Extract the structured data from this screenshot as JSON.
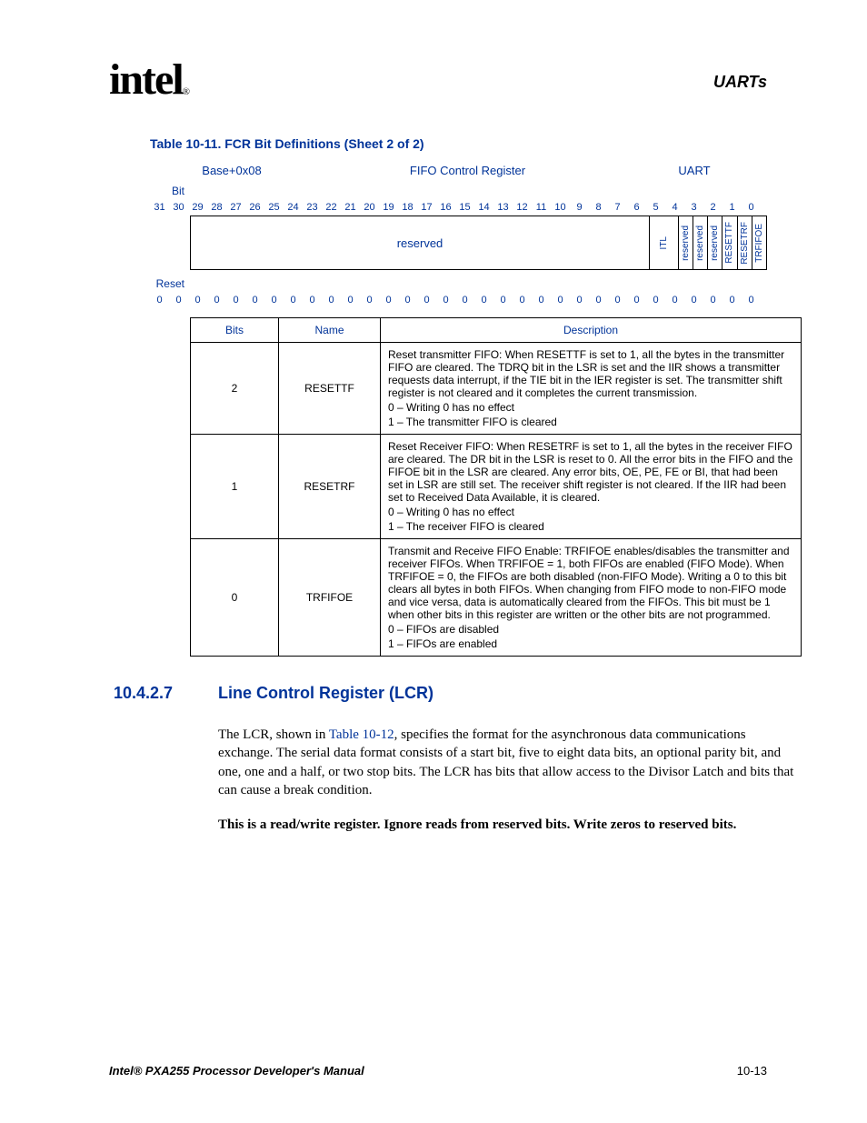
{
  "header": {
    "logo_text": "intel",
    "logo_r": "®",
    "chapter_title": "UARTs"
  },
  "table_title": "Table 10-11. FCR Bit Definitions (Sheet 2 of 2)",
  "register": {
    "address": "Base+0x08",
    "name": "FIFO Control Register",
    "module": "UART"
  },
  "labels": {
    "bit": "Bit",
    "reset": "Reset",
    "bits_col": "Bits",
    "name_col": "Name",
    "desc_col": "Description"
  },
  "bit_numbers": [
    "31",
    "30",
    "29",
    "28",
    "27",
    "26",
    "25",
    "24",
    "23",
    "22",
    "21",
    "20",
    "19",
    "18",
    "17",
    "16",
    "15",
    "14",
    "13",
    "12",
    "11",
    "10",
    "9",
    "8",
    "7",
    "6",
    "5",
    "4",
    "3",
    "2",
    "1",
    "0"
  ],
  "field_names": {
    "reserved": "reserved",
    "f7": "ITL",
    "f6": "ITL",
    "f5": "reserved",
    "f4": "reserved",
    "f3": "reserved",
    "f2": "RESETTF",
    "f1": "RESETRF",
    "f0": "TRFIFOE"
  },
  "reset_values": [
    "0",
    "0",
    "0",
    "0",
    "0",
    "0",
    "0",
    "0",
    "0",
    "0",
    "0",
    "0",
    "0",
    "0",
    "0",
    "0",
    "0",
    "0",
    "0",
    "0",
    "0",
    "0",
    "0",
    "0",
    "0",
    "0",
    "0",
    "0",
    "0",
    "0",
    "0",
    "0"
  ],
  "rows": [
    {
      "bits": "2",
      "name": "RESETTF",
      "desc_main": "Reset transmitter FIFO: When RESETTF is set to 1, all the bytes in the transmitter FIFO are cleared. The TDRQ bit in the LSR is set and the IIR shows a transmitter requests data interrupt, if the TIE bit in the IER register is set. The transmitter shift register is not cleared and it completes the current transmission.",
      "val0": "0 –  Writing 0 has no effect",
      "val1": "1 –  The transmitter FIFO is cleared"
    },
    {
      "bits": "1",
      "name": "RESETRF",
      "desc_main": "Reset Receiver FIFO: When RESETRF is set to 1, all the bytes in the receiver FIFO are cleared. The DR bit in the LSR is reset to 0. All the error bits in the FIFO and the FIFOE bit in the LSR are cleared. Any error bits, OE, PE, FE or BI, that had been set in LSR are still set. The receiver shift register is not cleared. If the IIR had been set to Received Data Available, it is cleared.",
      "val0": "0 –  Writing 0 has no effect",
      "val1": "1 –  The receiver FIFO is cleared"
    },
    {
      "bits": "0",
      "name": "TRFIFOE",
      "desc_main": "Transmit and Receive FIFO Enable: TRFIFOE enables/disables the transmitter and receiver FIFOs. When TRFIFOE = 1, both FIFOs are enabled (FIFO Mode). When TRFIFOE = 0, the FIFOs are both disabled (non-FIFO Mode). Writing a 0 to this bit clears all bytes in both FIFOs. When changing from FIFO mode to non-FIFO mode and vice versa, data is automatically cleared from the FIFOs. This bit must be 1 when other bits in this register are written or the other bits are not programmed.",
      "val0": "0 –  FIFOs are disabled",
      "val1": "1 –  FIFOs are enabled"
    }
  ],
  "section": {
    "number": "10.4.2.7",
    "title": "Line Control Register (LCR)"
  },
  "paragraph1a": "The LCR, shown in ",
  "paragraph1_xref": "Table 10-12",
  "paragraph1b": ", specifies the format for the asynchronous data communications exchange. The serial data format consists of a start bit, five to eight data bits, an optional parity bit, and one, one and a half, or two stop bits. The LCR has bits that allow access to the Divisor Latch and bits that can cause a break condition.",
  "paragraph2": "This is a read/write register. Ignore reads from reserved bits. Write zeros to reserved bits.",
  "footer": {
    "left": "Intel® PXA255 Processor Developer's Manual",
    "right": "10-13"
  }
}
